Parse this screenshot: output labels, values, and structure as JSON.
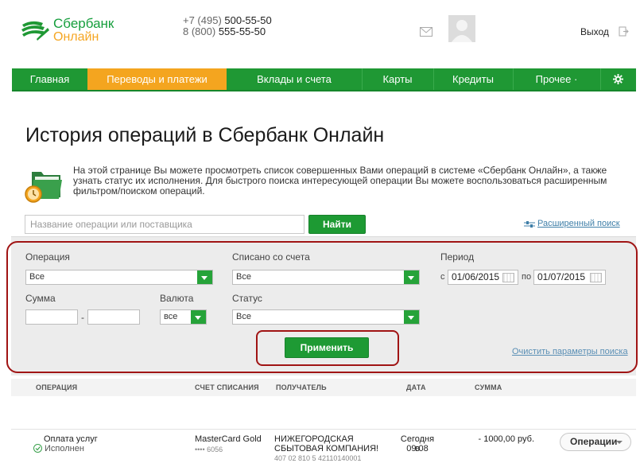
{
  "brand": {
    "name_line1": "Сбербанк",
    "name_line2": "Онлайн",
    "colors": {
      "green": "#1f9834",
      "orange": "#f4a51f",
      "highlight": "#a01414"
    }
  },
  "header": {
    "phone1_code": "+7 (495) ",
    "phone1_number": "500-55-50",
    "phone2_code": "8 (800) ",
    "phone2_number": "555-55-50",
    "logout_label": "Выход"
  },
  "nav": {
    "items": [
      {
        "label": "Главная"
      },
      {
        "label": "Переводы и платежи",
        "active": true
      },
      {
        "label": "Вклады и счета"
      },
      {
        "label": "Карты"
      },
      {
        "label": "Кредиты"
      },
      {
        "label": "Прочее ·"
      }
    ],
    "settings_icon": "gear-icon"
  },
  "page": {
    "title": "История операций в Сбербанк Онлайн",
    "description": "На этой странице Вы можете просмотреть список совершенных Вами операций в системе «Сбербанк Онлайн», а также узнать статус их исполнения. Для быстрого поиска интересующей операции Вы можете воспользоваться расширенным фильтром/поиском операций."
  },
  "search": {
    "placeholder": "Название операции или поставщика",
    "find_label": "Найти",
    "advanced_label": "Расширенный поиск"
  },
  "filters": {
    "operation_label": "Операция",
    "operation_value": "Все",
    "account_label": "Списано со счета",
    "account_value": "Все",
    "period_label": "Период",
    "period_from_prefix": "с",
    "period_from": "01/06/2015",
    "period_to_prefix": "по",
    "period_to": "01/07/2015",
    "sum_label": "Сумма",
    "sum_dash": "-",
    "currency_label": "Валюта",
    "currency_value": "все",
    "status_label": "Статус",
    "status_value": "Все",
    "apply_label": "Применить",
    "clear_label": "Очистить параметры поиска"
  },
  "table": {
    "headers": {
      "operation": "ОПЕРАЦИЯ",
      "account": "СЧЕТ СПИСАНИЯ",
      "recipient": "ПОЛУЧАТЕЛЬ",
      "date": "ДАТА",
      "sum": "СУММА"
    },
    "rows": [
      {
        "operation": "Оплата услуг",
        "status": "Исполнен",
        "account": "MasterCard Gold",
        "account_number": "•••• 6056",
        "recipient_line1": "НИЖЕГОРОДСКАЯ",
        "recipient_line2": "СБЫТОВАЯ КОМПАНИЯ!",
        "recipient_number": "407 02 810 5 42110140001",
        "date_line1": "Сегодня в",
        "date_line2": "09:08",
        "sum": "- 1000,00 руб.",
        "actions_label": "Операции"
      }
    ]
  }
}
